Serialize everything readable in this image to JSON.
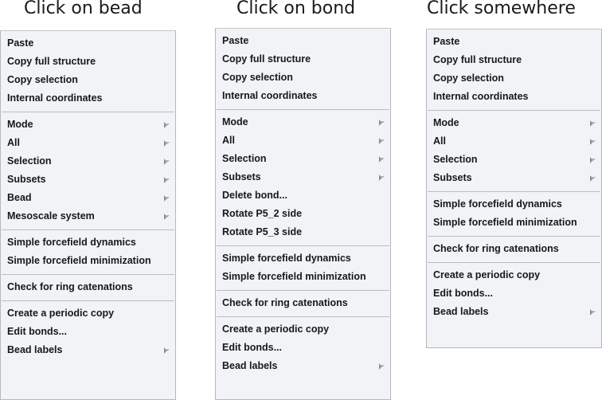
{
  "page": {
    "background_color": "#ffffff",
    "menu_background_color": "#f1f3f7",
    "menu_border_color": "#b4b7bd",
    "separator_color": "#b9bcc2",
    "text_color": "#16181c",
    "title_color": "#1a1a1a",
    "submenu_arrow_color": "#6d7076"
  },
  "columns": [
    {
      "title": "Click on bead",
      "menu": {
        "groups": [
          {
            "items": [
              {
                "label": "Paste",
                "submenu": false
              },
              {
                "label": "Copy full structure",
                "submenu": false
              },
              {
                "label": "Copy selection",
                "submenu": false
              },
              {
                "label": "Internal coordinates",
                "submenu": false
              }
            ]
          },
          {
            "items": [
              {
                "label": "Mode",
                "submenu": true
              },
              {
                "label": "All",
                "submenu": true
              },
              {
                "label": "Selection",
                "submenu": true
              },
              {
                "label": "Subsets",
                "submenu": true
              },
              {
                "label": "Bead",
                "submenu": true
              },
              {
                "label": "Mesoscale system",
                "submenu": true
              }
            ]
          },
          {
            "items": [
              {
                "label": "Simple forcefield dynamics",
                "submenu": false
              },
              {
                "label": "Simple forcefield minimization",
                "submenu": false
              }
            ]
          },
          {
            "items": [
              {
                "label": "Check for ring catenations",
                "submenu": false
              }
            ]
          },
          {
            "items": [
              {
                "label": "Create a periodic copy",
                "submenu": false
              },
              {
                "label": "Edit bonds...",
                "submenu": false
              },
              {
                "label": "Bead labels",
                "submenu": true
              }
            ]
          }
        ]
      }
    },
    {
      "title": "Click on bond",
      "menu": {
        "groups": [
          {
            "items": [
              {
                "label": "Paste",
                "submenu": false
              },
              {
                "label": "Copy full structure",
                "submenu": false
              },
              {
                "label": "Copy selection",
                "submenu": false
              },
              {
                "label": "Internal coordinates",
                "submenu": false
              }
            ]
          },
          {
            "items": [
              {
                "label": "Mode",
                "submenu": true
              },
              {
                "label": "All",
                "submenu": true
              },
              {
                "label": "Selection",
                "submenu": true
              },
              {
                "label": "Subsets",
                "submenu": true
              },
              {
                "label": "Delete bond...",
                "submenu": false
              },
              {
                "label": "Rotate P5_2 side",
                "submenu": false
              },
              {
                "label": "Rotate P5_3 side",
                "submenu": false
              }
            ]
          },
          {
            "items": [
              {
                "label": "Simple forcefield dynamics",
                "submenu": false
              },
              {
                "label": "Simple forcefield minimization",
                "submenu": false
              }
            ]
          },
          {
            "items": [
              {
                "label": "Check for ring catenations",
                "submenu": false
              }
            ]
          },
          {
            "items": [
              {
                "label": "Create a periodic copy",
                "submenu": false
              },
              {
                "label": "Edit bonds...",
                "submenu": false
              },
              {
                "label": "Bead labels",
                "submenu": true
              }
            ]
          }
        ]
      }
    },
    {
      "title": "Click somewhere",
      "menu": {
        "groups": [
          {
            "items": [
              {
                "label": "Paste",
                "submenu": false
              },
              {
                "label": "Copy full structure",
                "submenu": false
              },
              {
                "label": "Copy selection",
                "submenu": false
              },
              {
                "label": "Internal coordinates",
                "submenu": false
              }
            ]
          },
          {
            "items": [
              {
                "label": "Mode",
                "submenu": true
              },
              {
                "label": "All",
                "submenu": true
              },
              {
                "label": "Selection",
                "submenu": true
              },
              {
                "label": "Subsets",
                "submenu": true
              }
            ]
          },
          {
            "items": [
              {
                "label": "Simple forcefield dynamics",
                "submenu": false
              },
              {
                "label": "Simple forcefield minimization",
                "submenu": false
              }
            ]
          },
          {
            "items": [
              {
                "label": "Check for ring catenations",
                "submenu": false
              }
            ]
          },
          {
            "items": [
              {
                "label": "Create a periodic copy",
                "submenu": false
              },
              {
                "label": "Edit bonds...",
                "submenu": false
              },
              {
                "label": "Bead labels",
                "submenu": true
              }
            ]
          }
        ]
      }
    }
  ]
}
